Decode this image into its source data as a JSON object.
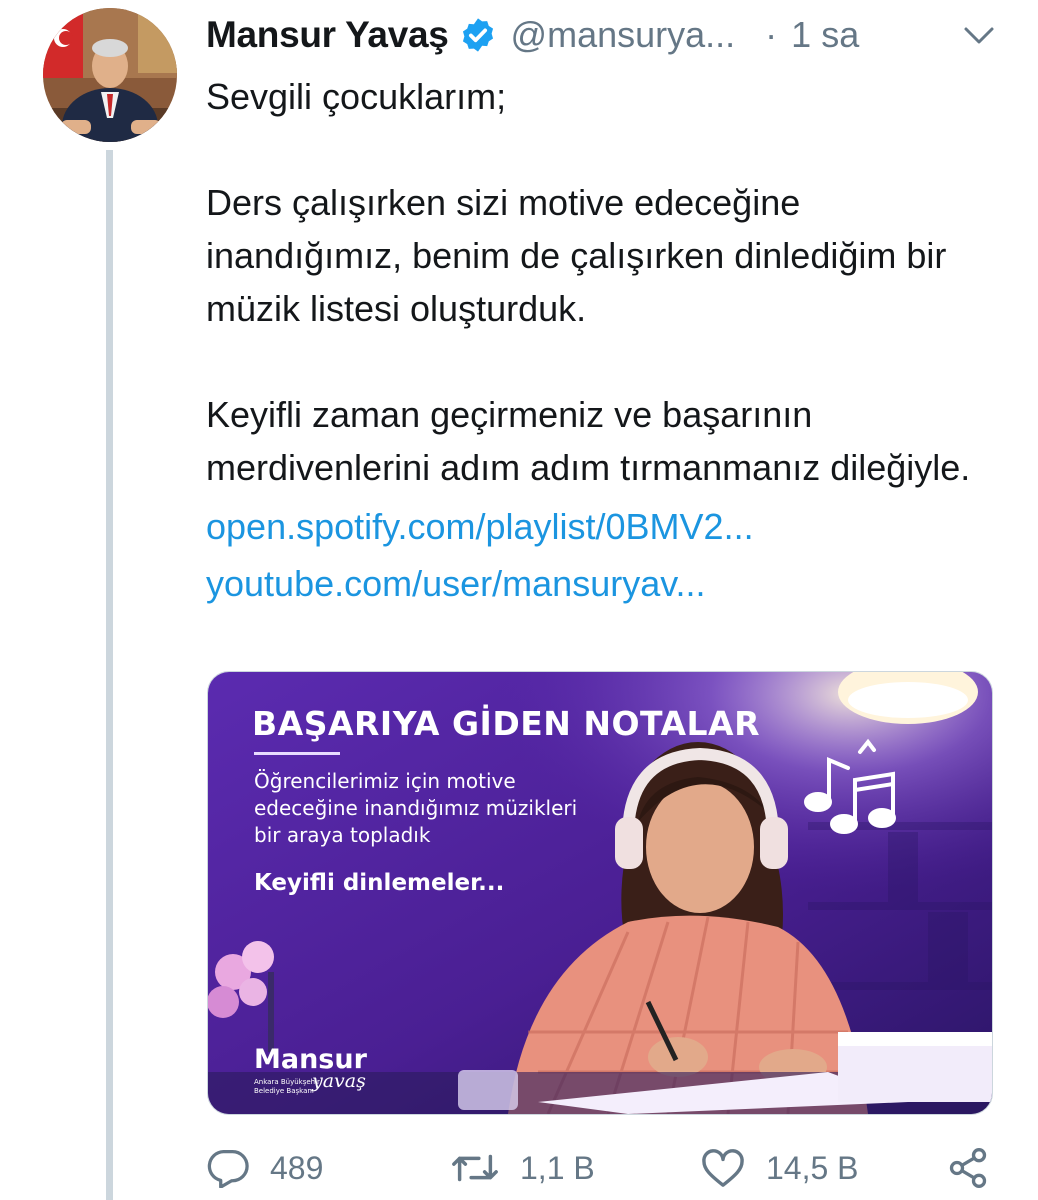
{
  "tweet": {
    "author_name": "Mansur Yavaş",
    "author_handle": "@mansurya...",
    "separator": "·",
    "time": "1 sa",
    "text_p1": "Sevgili çocuklarım;",
    "text_p2": "Ders çalışırken sizi motive edeceğine inandığımız, benim de çalışırken dinlediğim bir müzik listesi oluşturduk.",
    "text_p3": "Keyifli zaman geçirmeniz ve başarının merdivenlerini adım adım tırmanmanız dileğiyle.",
    "link_spotify": "open.spotify.com/playlist/0BMV2...",
    "link_youtube": "youtube.com/user/mansuryav..."
  },
  "media": {
    "headline": "BAŞARIYA GİDEN NOTALAR",
    "subtext_line1": "Öğrencilerimiz için motive",
    "subtext_line2": "edeceğine inandığımız müzikleri",
    "subtext_line3": "bir araya topladık",
    "tagline": "Keyifli dinlemeler...",
    "logo_name": "Mansur",
    "logo_script": "yavaş",
    "logo_sub1": "Ankara Büyükşehir",
    "logo_sub2": "Belediye Başkanı"
  },
  "actions": {
    "reply_count": "489",
    "retweet_count": "1,1 B",
    "like_count": "14,5 B"
  },
  "colors": {
    "link": "#1b95e0",
    "secondary_text": "#657786",
    "verified": "#1da1f2",
    "thread_line": "#ccd6dd",
    "media_purple": "#5a2aa8"
  },
  "icons": [
    "verified-badge-icon",
    "chevron-down-icon",
    "reply-icon",
    "retweet-icon",
    "like-icon",
    "share-icon",
    "music-notes-icon"
  ]
}
